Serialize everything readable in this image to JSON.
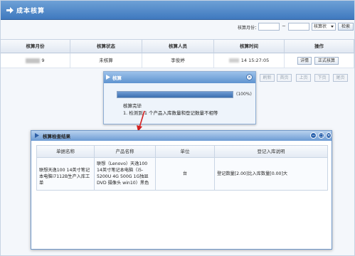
{
  "header": {
    "title": "成本核算"
  },
  "filter": {
    "month_label": "核算月份：",
    "separator": "~",
    "status_select": "核算状",
    "search_button": "检索"
  },
  "table": {
    "columns": [
      "核算月份",
      "核算状态",
      "核算人员",
      "核算时间",
      "操作"
    ],
    "row": {
      "month": "9",
      "status": "未核算",
      "operator": "李俊婷",
      "time": "14 15:27:05",
      "detail_button": "详情",
      "formal_button": "正式核算"
    }
  },
  "pager": [
    "刷新",
    "首页",
    "上页",
    "下页",
    "尾页"
  ],
  "calc_dialog": {
    "title": "核算",
    "progress": 100,
    "progress_text": "(100%)",
    "done_text": "核算完毕",
    "check_text": "1. 检测到 1 个产品入库数量和登记数量不相等"
  },
  "result_dialog": {
    "title": "核算检查结果",
    "columns": [
      "单据名称",
      "产品名称",
      "单位",
      "登记入库说明"
    ],
    "row": {
      "doc_name": "联想天逸100 14英寸笔记本电脑i7112B生产入库工单",
      "product_name": "联想（Lenovo）天逸100 14英寸笔记本电脑（i5-5200U 4G 500G 1G独显 DVD 摄像头 win10）黑色",
      "unit": "台",
      "note": "登记数量[2.00]比入库数量[0.00]大"
    }
  }
}
